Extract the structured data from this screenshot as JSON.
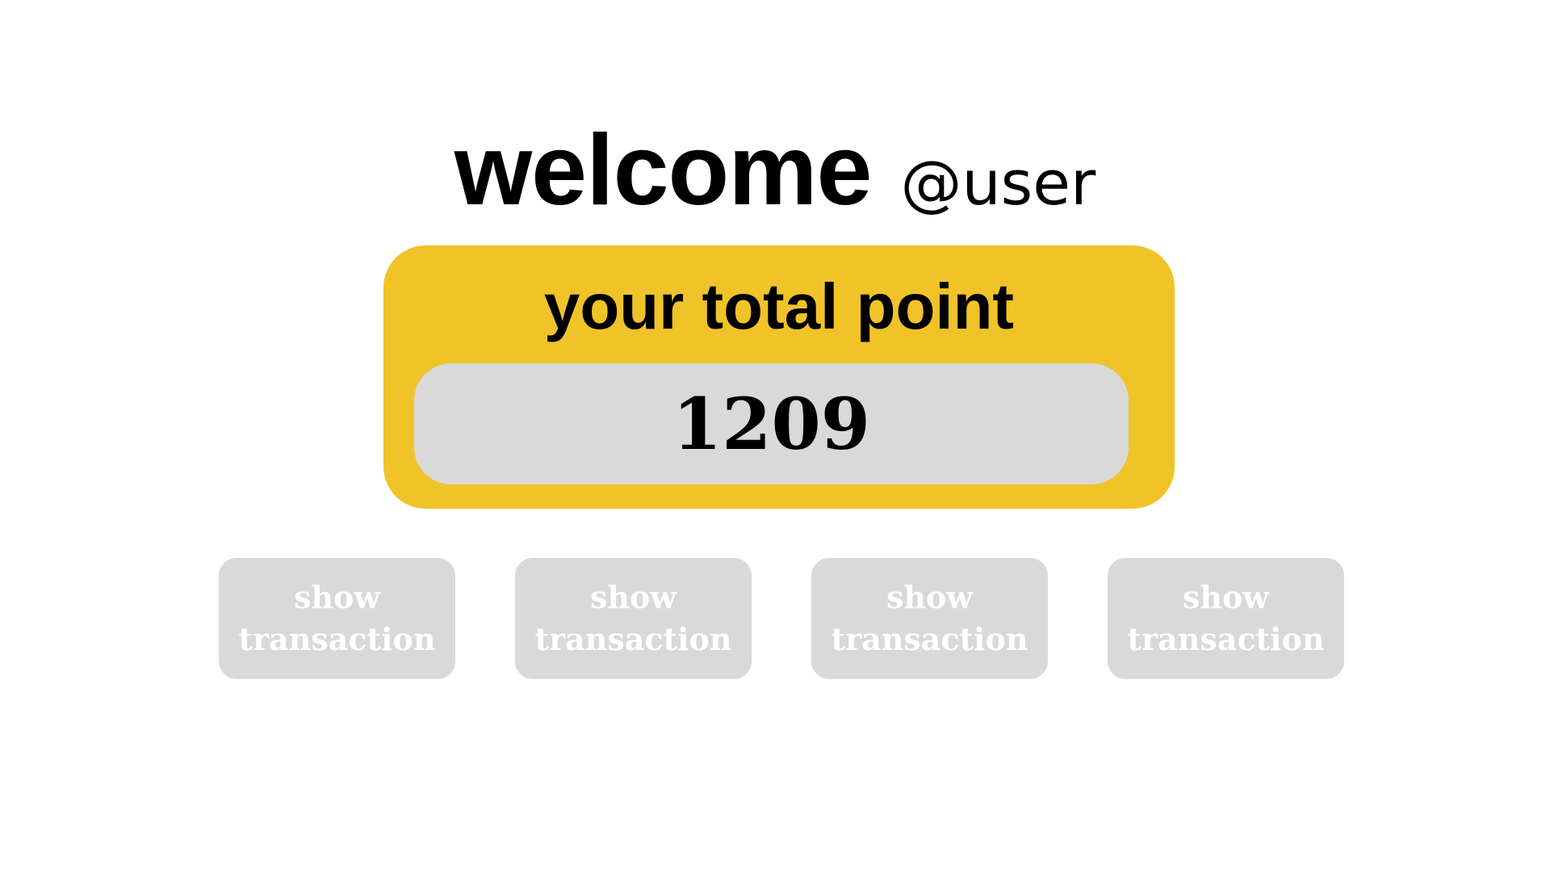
{
  "header": {
    "welcome_text": "welcome",
    "username": "@user"
  },
  "points_card": {
    "title": "your total point",
    "value": "1209",
    "accent_color": "#f0c329",
    "value_box_color": "#d9d9d9"
  },
  "actions": {
    "buttons": [
      {
        "line1": "show",
        "line2": "transaction"
      },
      {
        "line1": "show",
        "line2": "transaction"
      },
      {
        "line1": "show",
        "line2": "transaction"
      },
      {
        "line1": "show",
        "line2": "transaction"
      }
    ],
    "button_color": "#d9d9d9",
    "button_text_color": "#ffffff"
  }
}
